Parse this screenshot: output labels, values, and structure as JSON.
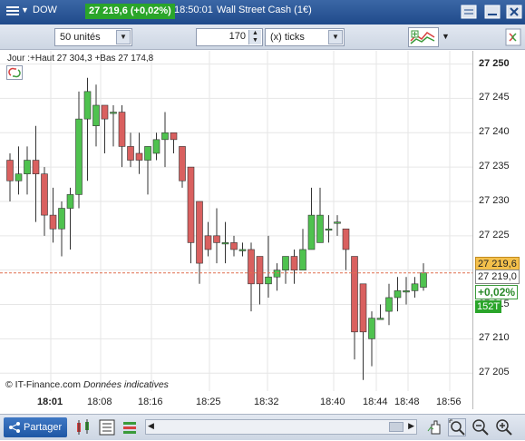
{
  "topbar": {
    "symbol": "DOW",
    "price_badge": "27 219,6 (+0,02%)",
    "time": "18:50:01",
    "instrument": "Wall Street Cash (1€)"
  },
  "controls": {
    "units_value": "50 unités",
    "ticks_value": "170",
    "ticks_unit": "(x) ticks"
  },
  "legend": {
    "text": "Jour :+Haut 27 304,3 +Bas 27 174,8"
  },
  "axis": {
    "y_ticks": [
      "27 250",
      "27 245",
      "27 240",
      "27 235",
      "27 230",
      "27 225",
      "27 215",
      "27 210",
      "27 205"
    ],
    "x_ticks": [
      "18:01",
      "18:08",
      "18:16",
      "18:25",
      "18:32",
      "18:40",
      "18:44",
      "18:48",
      "18:56"
    ]
  },
  "price_tags": {
    "last": "27 219,6",
    "ref": "27 219,0",
    "change": "+0,02%",
    "volume": "152T"
  },
  "footer": {
    "share_label": "Partager",
    "copyright": "© IT-Finance.com",
    "disclaimer": "Données indicatives"
  },
  "colors": {
    "up": "#4fc24f",
    "down": "#d9605f",
    "accent": "#1f4a8a",
    "last_line": "#e07050"
  },
  "chart_data": {
    "type": "candlestick",
    "ylim": [
      27203,
      27252
    ],
    "candles": [
      {
        "o": 27236,
        "h": 27237,
        "l": 27230,
        "c": 27233
      },
      {
        "o": 27233,
        "h": 27238,
        "l": 27231,
        "c": 27234
      },
      {
        "o": 27234,
        "h": 27238,
        "l": 27231,
        "c": 27236
      },
      {
        "o": 27236,
        "h": 27241,
        "l": 27227,
        "c": 27234
      },
      {
        "o": 27234,
        "h": 27235,
        "l": 27225,
        "c": 27228
      },
      {
        "o": 27228,
        "h": 27232,
        "l": 27224,
        "c": 27226
      },
      {
        "o": 27226,
        "h": 27230,
        "l": 27222,
        "c": 27229
      },
      {
        "o": 27229,
        "h": 27232,
        "l": 27223,
        "c": 27231
      },
      {
        "o": 27231,
        "h": 27246,
        "l": 27229,
        "c": 27242
      },
      {
        "o": 27242,
        "h": 27248,
        "l": 27233,
        "c": 27246
      },
      {
        "o": 27241,
        "h": 27247,
        "l": 27238,
        "c": 27244
      },
      {
        "o": 27244,
        "h": 27244,
        "l": 27237,
        "c": 27242
      },
      {
        "o": 27243,
        "h": 27244,
        "l": 27238,
        "c": 27243
      },
      {
        "o": 27243,
        "h": 27244,
        "l": 27235,
        "c": 27238
      },
      {
        "o": 27238,
        "h": 27240,
        "l": 27235,
        "c": 27236
      },
      {
        "o": 27237,
        "h": 27240,
        "l": 27234,
        "c": 27236
      },
      {
        "o": 27236,
        "h": 27238,
        "l": 27231,
        "c": 27238
      },
      {
        "o": 27237,
        "h": 27240,
        "l": 27236,
        "c": 27239
      },
      {
        "o": 27239,
        "h": 27243,
        "l": 27235,
        "c": 27240
      },
      {
        "o": 27240,
        "h": 27240,
        "l": 27237,
        "c": 27239
      },
      {
        "o": 27238,
        "h": 27236,
        "l": 27232,
        "c": 27233
      },
      {
        "o": 27235,
        "h": 27235,
        "l": 27221,
        "c": 27224
      },
      {
        "o": 27230,
        "h": 27230,
        "l": 27218,
        "c": 27221
      },
      {
        "o": 27225,
        "h": 27227,
        "l": 27222,
        "c": 27223
      },
      {
        "o": 27225,
        "h": 27229,
        "l": 27221,
        "c": 27224
      },
      {
        "o": 27224,
        "h": 27227,
        "l": 27221,
        "c": 27224
      },
      {
        "o": 27224,
        "h": 27225,
        "l": 27222,
        "c": 27223
      },
      {
        "o": 27223,
        "h": 27224,
        "l": 27222,
        "c": 27223
      },
      {
        "o": 27223,
        "h": 27224,
        "l": 27214,
        "c": 27218
      },
      {
        "o": 27222,
        "h": 27222,
        "l": 27215,
        "c": 27218
      },
      {
        "o": 27218,
        "h": 27225,
        "l": 27216,
        "c": 27219
      },
      {
        "o": 27219,
        "h": 27221,
        "l": 27217,
        "c": 27220
      },
      {
        "o": 27220,
        "h": 27222,
        "l": 27218,
        "c": 27222
      },
      {
        "o": 27222,
        "h": 27223,
        "l": 27218,
        "c": 27220
      },
      {
        "o": 27220,
        "h": 27226,
        "l": 27220,
        "c": 27223
      },
      {
        "o": 27223,
        "h": 27232,
        "l": 27223,
        "c": 27228
      },
      {
        "o": 27224,
        "h": 27232,
        "l": 27224,
        "c": 27228
      },
      {
        "o": 27226,
        "h": 27228,
        "l": 27224,
        "c": 27226
      },
      {
        "o": 27227,
        "h": 27228,
        "l": 27225,
        "c": 27227
      },
      {
        "o": 27226,
        "h": 27224,
        "l": 27220,
        "c": 27223
      },
      {
        "o": 27222,
        "h": 27221,
        "l": 27207,
        "c": 27211
      },
      {
        "o": 27218,
        "h": 27218,
        "l": 27204,
        "c": 27211
      },
      {
        "o": 27210,
        "h": 27214,
        "l": 27206,
        "c": 27213
      },
      {
        "o": 27213,
        "h": 27215,
        "l": 27213,
        "c": 27213
      },
      {
        "o": 27214,
        "h": 27218,
        "l": 27212,
        "c": 27216
      },
      {
        "o": 27216,
        "h": 27219,
        "l": 27214,
        "c": 27217
      },
      {
        "o": 27217,
        "h": 27219,
        "l": 27215,
        "c": 27217
      },
      {
        "o": 27217,
        "h": 27219,
        "l": 27216,
        "c": 27218
      },
      {
        "o": 27217.5,
        "h": 27221,
        "l": 27217,
        "c": 27219.6
      }
    ]
  }
}
